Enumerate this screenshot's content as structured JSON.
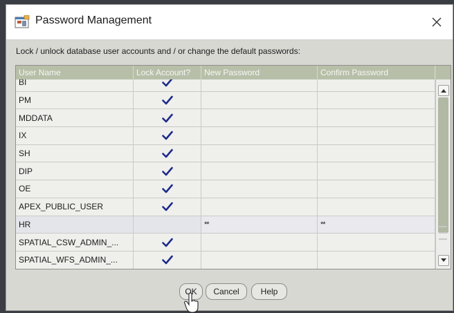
{
  "window": {
    "title": "Password Management",
    "close_label": "×"
  },
  "instruction": "Lock / unlock database user accounts and / or change the default passwords:",
  "grid": {
    "columns": [
      "User Name",
      "Lock Account?",
      "New Password",
      "Confirm Password"
    ],
    "rows": [
      {
        "user": "BI",
        "locked": true,
        "new_password": "",
        "confirm_password": ""
      },
      {
        "user": "PM",
        "locked": true,
        "new_password": "",
        "confirm_password": ""
      },
      {
        "user": "MDDATA",
        "locked": true,
        "new_password": "",
        "confirm_password": ""
      },
      {
        "user": "IX",
        "locked": true,
        "new_password": "",
        "confirm_password": ""
      },
      {
        "user": "SH",
        "locked": true,
        "new_password": "",
        "confirm_password": ""
      },
      {
        "user": "DIP",
        "locked": true,
        "new_password": "",
        "confirm_password": ""
      },
      {
        "user": "OE",
        "locked": true,
        "new_password": "",
        "confirm_password": ""
      },
      {
        "user": "APEX_PUBLIC_USER",
        "locked": true,
        "new_password": "",
        "confirm_password": ""
      },
      {
        "user": "HR",
        "locked": false,
        "new_password": "**",
        "confirm_password": "**",
        "selected": true
      },
      {
        "user": "SPATIAL_CSW_ADMIN_...",
        "locked": true,
        "new_password": "",
        "confirm_password": ""
      },
      {
        "user": "SPATIAL_WFS_ADMIN_...",
        "locked": true,
        "new_password": "",
        "confirm_password": ""
      }
    ]
  },
  "buttons": {
    "ok": "OK",
    "cancel": "Cancel",
    "help": "Help"
  },
  "colors": {
    "header_bg": "#b7bfa8",
    "checkmark": "#1d2a8a"
  },
  "icons": {
    "app": "oracle-window-icon",
    "close": "close-icon",
    "check": "checkmark-icon",
    "scroll_up": "chevron-up-icon",
    "scroll_down": "chevron-down-icon",
    "cursor": "hand-cursor-icon"
  }
}
